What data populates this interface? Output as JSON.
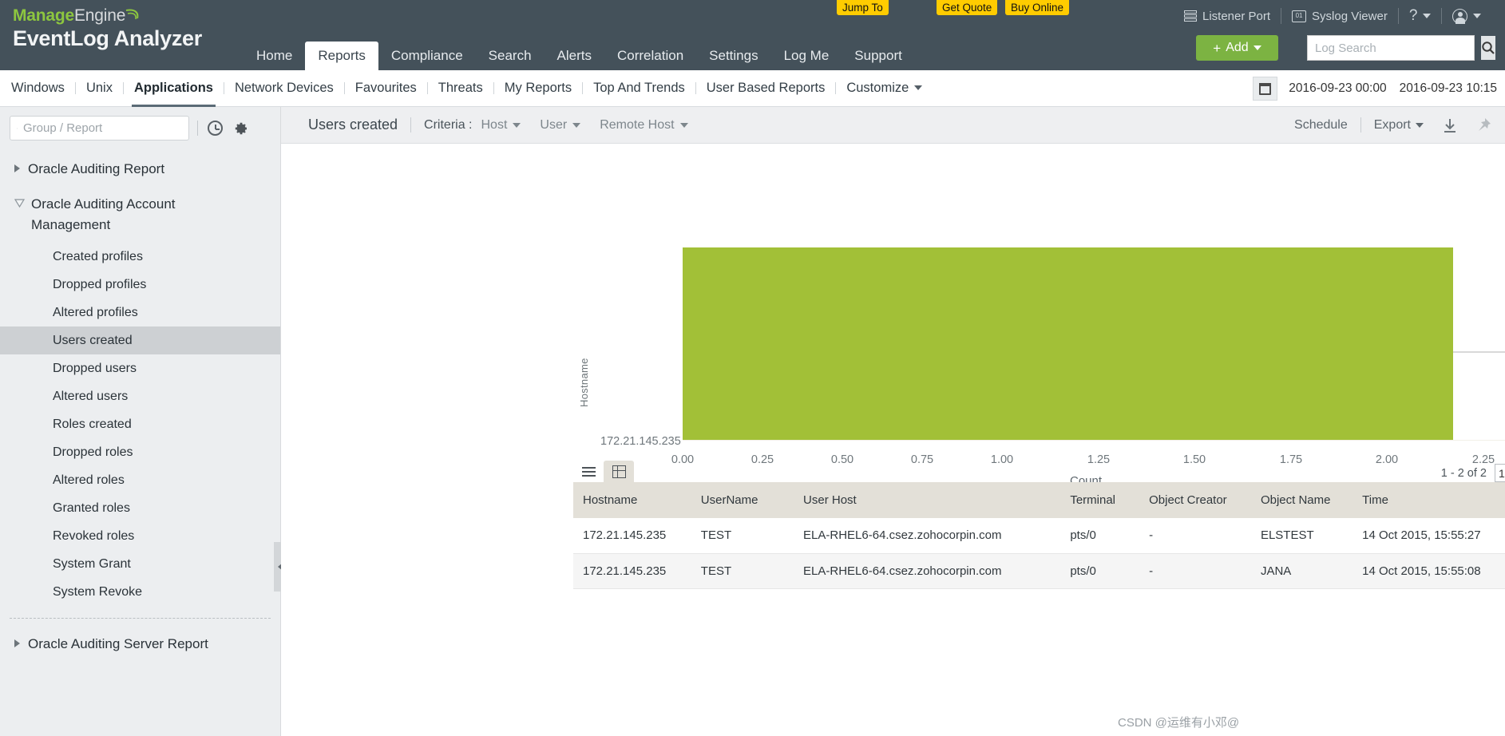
{
  "brand": {
    "manage": "Manage",
    "engine": "Engine",
    "product": "EventLog Analyzer"
  },
  "header": {
    "promos": [
      {
        "label": "Jump To",
        "name": "jump-to-button"
      },
      {
        "label": "Get Quote",
        "name": "get-quote-button"
      },
      {
        "label": "Buy Online",
        "name": "buy-online-button"
      }
    ],
    "utilities": {
      "listener_port": "Listener Port",
      "syslog_viewer": "Syslog Viewer",
      "help": "?",
      "syslog_icon_text": "01"
    },
    "main_nav": [
      {
        "label": "Home",
        "active": false
      },
      {
        "label": "Reports",
        "active": true
      },
      {
        "label": "Compliance",
        "active": false
      },
      {
        "label": "Search",
        "active": false
      },
      {
        "label": "Alerts",
        "active": false
      },
      {
        "label": "Correlation",
        "active": false
      },
      {
        "label": "Settings",
        "active": false
      },
      {
        "label": "Log Me",
        "active": false
      },
      {
        "label": "Support",
        "active": false
      }
    ],
    "add_button": "Add",
    "add_plus": "+",
    "search_placeholder": "Log Search",
    "search_value": ""
  },
  "subnav": {
    "items": [
      {
        "label": "Windows",
        "active": false
      },
      {
        "label": "Unix",
        "active": false
      },
      {
        "label": "Applications",
        "active": true
      },
      {
        "label": "Network Devices",
        "active": false
      },
      {
        "label": "Favourites",
        "active": false
      },
      {
        "label": "Threats",
        "active": false
      },
      {
        "label": "My Reports",
        "active": false
      },
      {
        "label": "Top And Trends",
        "active": false
      },
      {
        "label": "User Based Reports",
        "active": false
      }
    ],
    "customize": "Customize",
    "date_from": "2016-09-23 00:00",
    "date_to": "2016-09-23 10:15"
  },
  "sidebar": {
    "search_placeholder": "Group / Report",
    "search_value": "",
    "groups": [
      {
        "label": "Oracle Auditing Report",
        "expanded": false,
        "children": []
      },
      {
        "label": "Oracle Auditing Account Management",
        "expanded": true,
        "children": [
          {
            "label": "Created profiles",
            "selected": false
          },
          {
            "label": "Dropped profiles",
            "selected": false
          },
          {
            "label": "Altered profiles",
            "selected": false
          },
          {
            "label": "Users created",
            "selected": true
          },
          {
            "label": "Dropped users",
            "selected": false
          },
          {
            "label": "Altered users",
            "selected": false
          },
          {
            "label": "Roles created",
            "selected": false
          },
          {
            "label": "Dropped roles",
            "selected": false
          },
          {
            "label": "Altered roles",
            "selected": false
          },
          {
            "label": "Granted roles",
            "selected": false
          },
          {
            "label": "Revoked roles",
            "selected": false
          },
          {
            "label": "System Grant",
            "selected": false
          },
          {
            "label": "System Revoke",
            "selected": false
          }
        ]
      },
      {
        "label": "Oracle Auditing Server Report",
        "expanded": false,
        "children": []
      }
    ]
  },
  "report_toolbar": {
    "title": "Users created",
    "criteria_label": "Criteria :",
    "criteria": [
      {
        "label": "Host"
      },
      {
        "label": "User"
      },
      {
        "label": "Remote Host"
      }
    ],
    "schedule": "Schedule",
    "export": "Export"
  },
  "chart_data": {
    "type": "bar",
    "orientation": "horizontal",
    "title": "",
    "xlabel": "Count",
    "ylabel": "Hostname",
    "categories": [
      "172.21.145.235"
    ],
    "values": [
      2
    ],
    "xlim": [
      0,
      2.25
    ],
    "xticks": [
      "0.00",
      "0.25",
      "0.50",
      "0.75",
      "1.00",
      "1.25",
      "1.50",
      "1.75",
      "2.00",
      "2.25"
    ],
    "xtick_values": [
      0,
      0.25,
      0.5,
      0.75,
      1.0,
      1.25,
      1.5,
      1.75,
      2.0,
      2.25
    ],
    "grid": false,
    "legend": null,
    "bar_color": "#a2c037"
  },
  "table": {
    "pagination_text": "1 - 2 of 2",
    "page_size": "10",
    "columns": [
      "Hostname",
      "UserName",
      "User Host",
      "Terminal",
      "Object Creator",
      "Object Name",
      "Time"
    ],
    "rows": [
      [
        "172.21.145.235",
        "TEST",
        "ELA-RHEL6-64.csez.zohocorpin.com",
        "pts/0",
        "-",
        "ELSTEST",
        "14 Oct 2015, 15:55:27"
      ],
      [
        "172.21.145.235",
        "TEST",
        "ELA-RHEL6-64.csez.zohocorpin.com",
        "pts/0",
        "-",
        "JANA",
        "14 Oct 2015, 15:55:08"
      ]
    ]
  },
  "watermark": "CSDN @运维有小邓@",
  "colors": {
    "header_bg": "#44515a",
    "accent_green": "#7cb342",
    "bar_green": "#a2c037",
    "promo_yellow": "#ffcc00"
  }
}
